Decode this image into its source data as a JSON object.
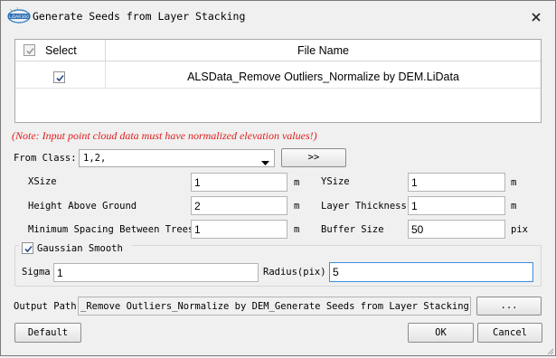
{
  "window": {
    "title": "Generate Seeds from Layer Stacking",
    "logo_text": "LiDAR360"
  },
  "table": {
    "col_select": "Select",
    "col_filename": "File Name",
    "rows": [
      {
        "checked": true,
        "file_name": "ALSData_Remove Outliers_Normalize by DEM.LiData"
      }
    ]
  },
  "note": "(Note: Input point cloud data must have normalized elevation values!)",
  "from_class": {
    "label": "From Class:",
    "value": "1,2,",
    "button": ">>"
  },
  "params": {
    "xsize_label": "XSize",
    "xsize_value": "1",
    "xsize_unit": "m",
    "ysize_label": "YSize",
    "ysize_value": "1",
    "ysize_unit": "m",
    "height_label": "Height Above Ground",
    "height_value": "2",
    "height_unit": "m",
    "layer_label": "Layer Thickness",
    "layer_value": "1",
    "layer_unit": "m",
    "minspace_label": "Minimum Spacing Between Trees",
    "minspace_value": "1",
    "minspace_unit": "m",
    "buffer_label": "Buffer Size",
    "buffer_value": "50",
    "buffer_unit": "pix"
  },
  "gaussian": {
    "label": "Gaussian Smooth",
    "checked": true,
    "sigma_label": "Sigma",
    "sigma_value": "1",
    "radius_label": "Radius(pix)",
    "radius_value": "5"
  },
  "output": {
    "label": "Output Path:",
    "value": "_Remove Outliers_Normalize by DEM_Generate Seeds from Layer Stacking.csv",
    "browse": "..."
  },
  "buttons": {
    "default": "Default",
    "ok": "OK",
    "cancel": "Cancel"
  },
  "colors": {
    "note": "#e21b1b",
    "focus_border": "#3c8de0"
  }
}
